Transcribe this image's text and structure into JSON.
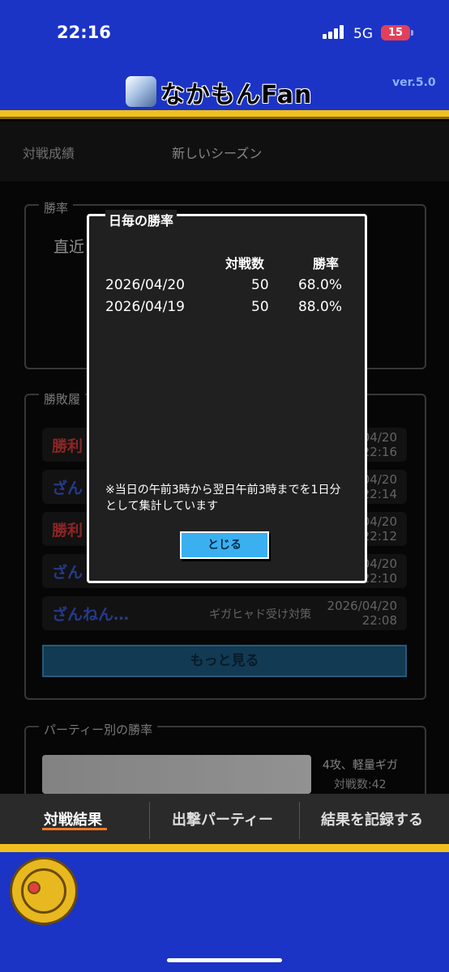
{
  "status": {
    "time": "22:16",
    "network": "5G",
    "battery": "15"
  },
  "header": {
    "app_name": "なかもんFan",
    "version": "ver.5.0"
  },
  "tabs": {
    "tab1": "対戦成績",
    "tab2": "新しいシーズン"
  },
  "winrate_panel": {
    "title": "勝率",
    "text": "直近"
  },
  "history_panel": {
    "title": "勝敗履",
    "rows": [
      {
        "result": "勝利",
        "date": "04/20",
        "time": "22:16"
      },
      {
        "result": "ざん",
        "date": "04/20",
        "time": "22:14"
      },
      {
        "result": "勝利",
        "date": "04/20",
        "time": "22:12"
      },
      {
        "result": "ざん",
        "date": "04/20",
        "time": "22:10"
      },
      {
        "result": "ざんねん…",
        "party": "ギガヒャド受け対策",
        "date": "2026/04/20",
        "time": "22:08"
      }
    ],
    "more_label": "もっと見る"
  },
  "party_panel": {
    "title": "パーティー別の勝率",
    "party_name": "4攻、軽量ギガ",
    "battles": "対戦数:42"
  },
  "modal": {
    "title": "日毎の勝率",
    "col_battles": "対戦数",
    "col_rate": "勝率",
    "rows": [
      {
        "date": "2026/04/20",
        "battles": "50",
        "rate": "68.0%"
      },
      {
        "date": "2026/04/19",
        "battles": "50",
        "rate": "88.0%"
      }
    ],
    "note": "※当日の午前3時から翌日午前3時までを1日分として集計しています",
    "close_label": "とじる"
  },
  "bottom_nav": {
    "tab1": "対戦結果",
    "tab2": "出撃パーティー",
    "tab3": "結果を記録する"
  },
  "colors": {
    "header_blue": "#1b34c6",
    "gold": "#f0c020",
    "win_red": "#d63a3a",
    "lose_blue": "#3a5ad6",
    "accent_orange": "#f07a20"
  }
}
